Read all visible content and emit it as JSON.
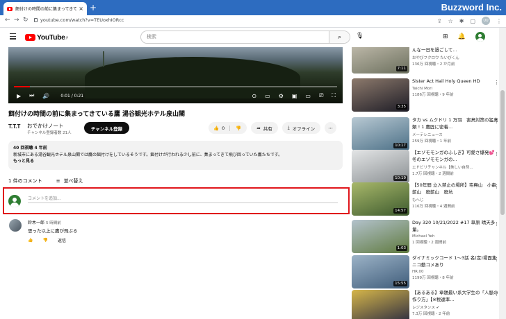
{
  "browser": {
    "tab_title": "餌付けの時間の前に集まってきている鷹 ...",
    "tab_close": "×",
    "new_tab": "+",
    "brand": "Buzzword Inc.",
    "url": "youtube.com/watch?v=TEUoxhIORcc",
    "back": "←",
    "forward": "→",
    "reload": "↻",
    "profile_initials": "UU"
  },
  "header": {
    "logo_text": "YouTube",
    "logo_sup": "JP",
    "search_placeholder": "検索"
  },
  "video": {
    "time": "0:01 / 0:21",
    "progress_fraction": 0.05,
    "title": "餌付けの時間の前に集まってきている鷹 湯谷観光ホテル泉山閣",
    "channel_avatar_text": "T.T.T",
    "channel_name": "おでかけノート",
    "channel_subs": "チャンネル登録者数 21人",
    "subscribe_label": "チャンネル登録",
    "like_count": "0",
    "share_label": "共有",
    "offline_label": "オフライン",
    "desc_stats": "40 回視聴  4 年前",
    "desc_text": "新城市にある湯谷観光ホテル泉山閣では鷹の餌付けをしているそうです。餌付けが行われる少し前に、集まってきて飛び回っていた鷹たちです。",
    "desc_more": "もっと見る"
  },
  "comments": {
    "count_label": "1 件のコメント",
    "sort_label": "並べ替え",
    "input_placeholder": "コメントを追加...",
    "items": [
      {
        "author": "鈴木一郎",
        "time": "5 時間前",
        "text": "思った以上に鷹が飛ぶる",
        "reply": "返信"
      }
    ]
  },
  "sidebar": {
    "items": [
      {
        "title": "アクーに野生 化コマテルケ犬で男性はどんな一日を過ごして…",
        "channel": "おやびフクロウ たいびくん",
        "meta": "136万 回視聴・2 か月前",
        "duration": "7:11",
        "thumb_colors": [
          "#6b6f5d",
          "#c7c1b2"
        ]
      },
      {
        "title": "Sister Act Hail Holy Queen HD",
        "channel": "Taichi Mori",
        "meta": "1186万 回視聴・9 年前",
        "duration": "3:35",
        "thumb_colors": [
          "#1d1c26",
          "#8d7a6c"
        ]
      },
      {
        "title": "タカ vs ムクドリ 1 万羽　害鳥対策の猛禽類 ! 1 鷹匠に密着...",
        "channel": "メーテレニュース",
        "meta": "259万 回視聴・1 年前",
        "duration": "10:17",
        "thumb_colors": [
          "#4b6f86",
          "#b8c9d3"
        ]
      },
      {
        "title": "【エゾモモンガのふしぎ】可愛さ爆発💕冬のエゾモモンガの...",
        "channel": "エドビリチャンネル【美しい自然...",
        "meta": "1.7万 回視聴・2 週間前",
        "duration": "10:19",
        "thumb_colors": [
          "#8a8f92",
          "#e3e5e6"
        ]
      },
      {
        "title": "【50年間 立入禁止の場所】宅無山　小串鉱山　廃鉱山　廃坑",
        "channel": "もへじ",
        "meta": "116万 回視聴・4 週間前",
        "duration": "14:57",
        "thumb_colors": [
          "#3d5a2e",
          "#a8b86a"
        ]
      },
      {
        "title": "Day 320 10/21/2022 #17 草原 晴天多量。",
        "channel": "Michael Yeh",
        "meta": "1 回視聴・2 週間前",
        "duration": "1:03",
        "thumb_colors": [
          "#5f7a3e",
          "#b3c2cc"
        ]
      },
      {
        "title": "ダイナミックコード 1〜3話 名(定)場面集 ニコ動コメあり",
        "channel": "HR.00",
        "meta": "1199万 回視聴・8 年前",
        "duration": "15:55",
        "thumb_colors": [
          "#3f5c7a",
          "#9cb3c7"
        ]
      },
      {
        "title": "【あるある】章題最い系大学生の「人脈の作り方」【※税違率...",
        "channel": "レジスタンス ✔",
        "meta": "7.3万 回視聴・2 年前",
        "duration": "",
        "thumb_colors": [
          "#2a2a40",
          "#d6b64a"
        ]
      }
    ]
  }
}
